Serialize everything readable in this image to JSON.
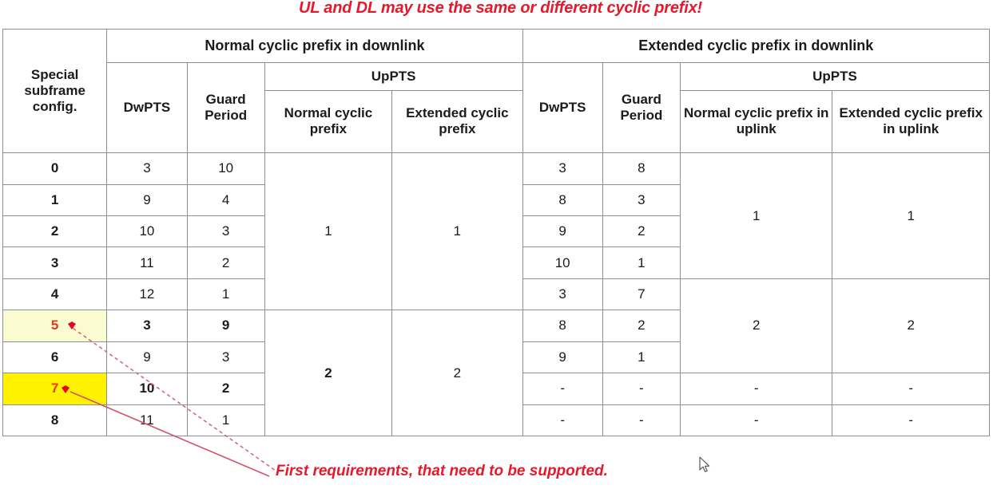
{
  "title": "UL and DL may use the same or different cyclic prefix!",
  "annotation": {
    "note": "First requirements, that need to be supported.",
    "cursor_icon": "mouse-pointer-icon"
  },
  "colors": {
    "header_blue": "#12a3ea",
    "header_gray": "#c2c6cb",
    "index_gray": "#b6bcc4",
    "highlight_light": "#fbfbd2",
    "highlight_strong": "#fff200",
    "accent_red": "#e8182b",
    "accent_orange": "#e8671a"
  },
  "table": {
    "headers": {
      "index_col": "Special subframe config.",
      "group_normal_dl": "Normal cyclic prefix in downlink",
      "group_extended_dl": "Extended cyclic prefix in downlink",
      "uppts": "UpPTS",
      "dwpts": "DwPTS",
      "guard_period": "Guard Period",
      "normal_cp": "Normal cyclic prefix",
      "extended_cp": "Extended cyclic prefix",
      "normal_cp_ul": "Normal cyclic prefix in uplink",
      "extended_cp_ul": "Extended cyclic prefix in uplink"
    },
    "rows": [
      {
        "config": "0",
        "ndl_dwpts": "3",
        "ndl_gp": "10",
        "edl_dwpts": "3",
        "edl_gp": "8"
      },
      {
        "config": "1",
        "ndl_dwpts": "9",
        "ndl_gp": "4",
        "edl_dwpts": "8",
        "edl_gp": "3"
      },
      {
        "config": "2",
        "ndl_dwpts": "10",
        "ndl_gp": "3",
        "edl_dwpts": "9",
        "edl_gp": "2"
      },
      {
        "config": "3",
        "ndl_dwpts": "11",
        "ndl_gp": "2",
        "edl_dwpts": "10",
        "edl_gp": "1"
      },
      {
        "config": "4",
        "ndl_dwpts": "12",
        "ndl_gp": "1",
        "edl_dwpts": "3",
        "edl_gp": "7"
      },
      {
        "config": "5",
        "ndl_dwpts": "3",
        "ndl_gp": "9",
        "edl_dwpts": "8",
        "edl_gp": "2"
      },
      {
        "config": "6",
        "ndl_dwpts": "9",
        "ndl_gp": "3",
        "edl_dwpts": "9",
        "edl_gp": "1"
      },
      {
        "config": "7",
        "ndl_dwpts": "10",
        "ndl_gp": "2",
        "edl_dwpts": "-",
        "edl_gp": "-"
      },
      {
        "config": "8",
        "ndl_dwpts": "11",
        "ndl_gp": "1",
        "edl_dwpts": "-",
        "edl_gp": "-"
      }
    ],
    "merged": {
      "ndl_uppts_normal_top": "1",
      "ndl_uppts_normal_bottom": "2",
      "ndl_uppts_extended_top": "1",
      "ndl_uppts_extended_bottom": "2",
      "edl_uppts_normal_top": "1",
      "edl_uppts_normal_bottom": "2",
      "edl_uppts_normal_dash1": "-",
      "edl_uppts_normal_dash2": "-",
      "edl_uppts_extended_top": "1",
      "edl_uppts_extended_bottom": "2",
      "edl_uppts_extended_dash1": "-",
      "edl_uppts_extended_dash2": "-"
    }
  }
}
